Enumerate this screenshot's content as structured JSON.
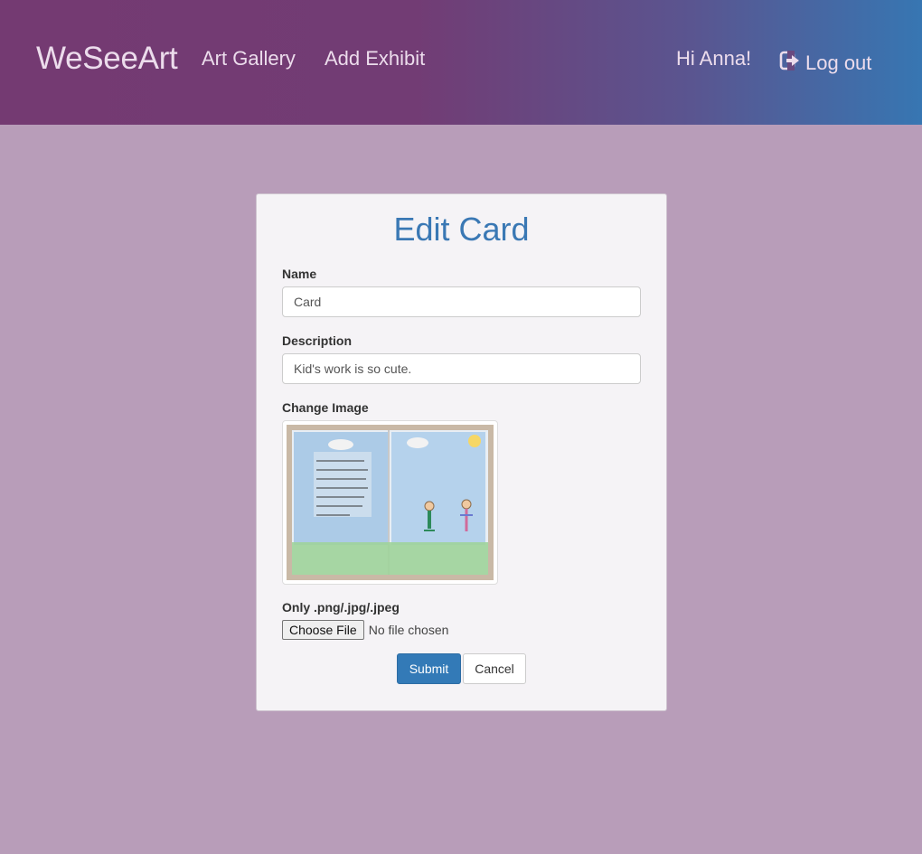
{
  "navbar": {
    "brand": "WeSeeArt",
    "links": [
      "Art Gallery",
      "Add Exhibit"
    ],
    "greeting": "Hi Anna!",
    "logout_label": "Log out",
    "logout_icon": "log-out-icon"
  },
  "form": {
    "title": "Edit Card",
    "name_label": "Name",
    "name_value": "Card",
    "description_label": "Description",
    "description_value": "Kid's work is so cute.",
    "image_label": "Change Image",
    "file_hint": "Only .png/.jpg/.jpeg",
    "file_button": "Choose File",
    "file_status": "No file chosen",
    "submit_label": "Submit",
    "cancel_label": "Cancel"
  },
  "colors": {
    "page_background": "#b89db9",
    "navbar_start": "#743a72",
    "navbar_end": "#3776b2",
    "title": "#3a78b4",
    "primary_button": "#337ab7"
  }
}
